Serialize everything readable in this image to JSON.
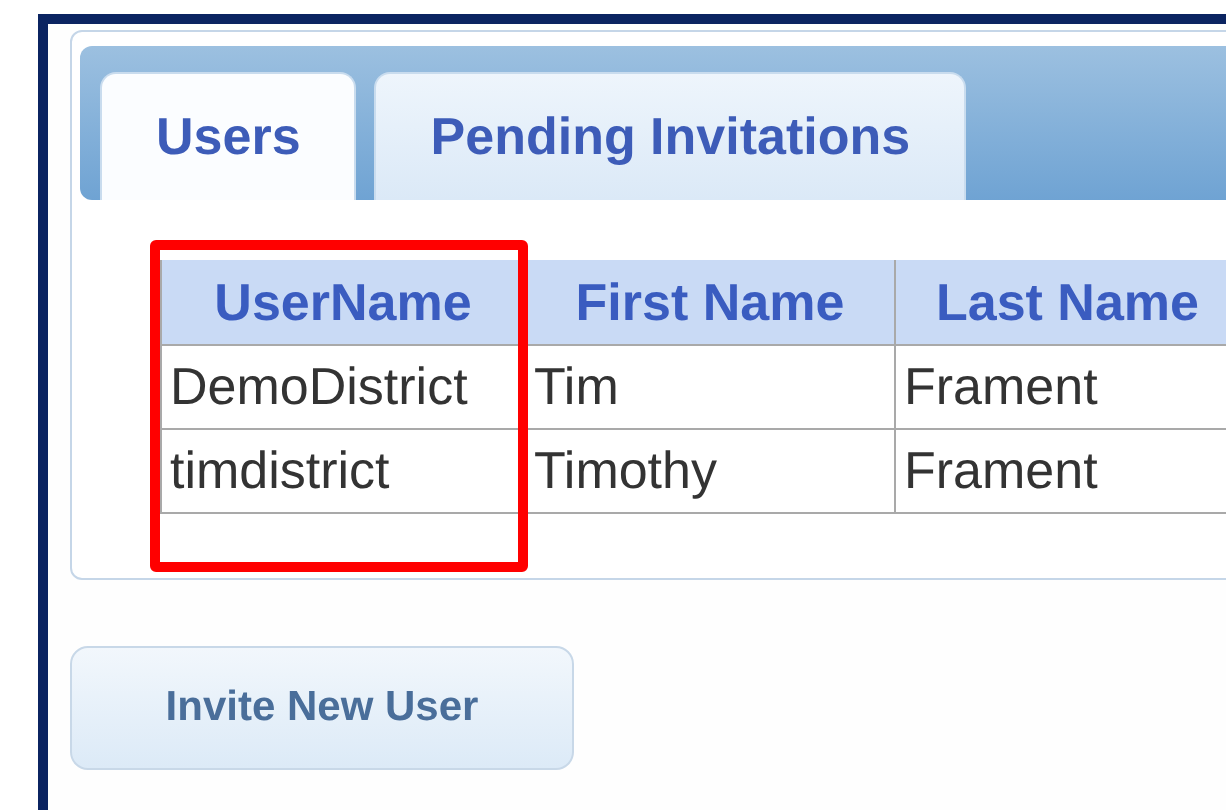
{
  "tabs": [
    {
      "label": "Users",
      "selected": true
    },
    {
      "label": "Pending Invitations",
      "selected": false
    }
  ],
  "table": {
    "columns": [
      "UserName",
      "First Name",
      "Last Name"
    ],
    "rows": [
      [
        "DemoDistrict",
        "Tim",
        "Frament"
      ],
      [
        "timdistrict",
        "Timothy",
        "Frament"
      ]
    ]
  },
  "annotation": {
    "kind": "box"
  },
  "buttons": [
    "Invite New User"
  ]
}
